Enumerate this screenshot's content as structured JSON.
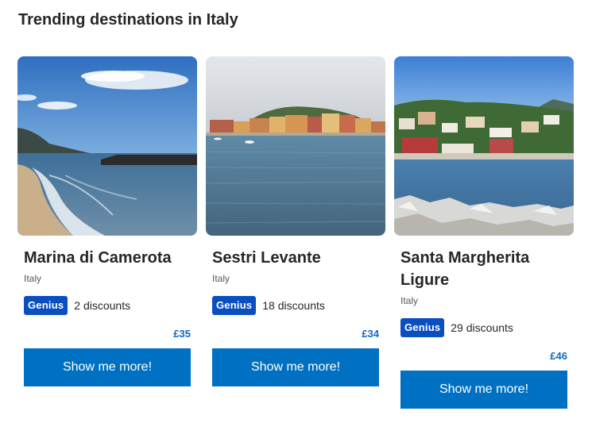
{
  "section": {
    "title": "Trending destinations in Italy"
  },
  "cards": [
    {
      "name": "Marina di Camerota",
      "country": "Italy",
      "badge": "Genius",
      "discounts": "2 discounts",
      "price": "£35",
      "button": "Show me more!"
    },
    {
      "name": "Sestri Levante",
      "country": "Italy",
      "badge": "Genius",
      "discounts": "18 discounts",
      "price": "£34",
      "button": "Show me more!"
    },
    {
      "name": "Santa Margherita Ligure",
      "country": "Italy",
      "badge": "Genius",
      "discounts": "29 discounts",
      "price": "£46",
      "button": "Show me more!"
    }
  ],
  "colors": {
    "primary_button": "#0071c2",
    "genius_badge": "#0a4fbf",
    "price_text": "#0a6cc2"
  }
}
